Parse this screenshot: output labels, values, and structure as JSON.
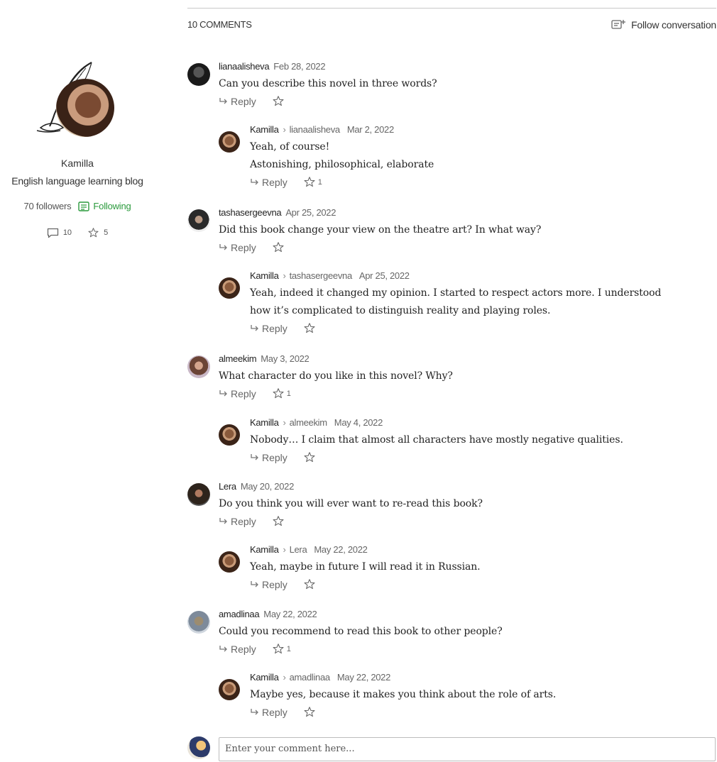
{
  "blog": {
    "name": "Kamilla",
    "description": "English language learning blog",
    "followers": "70 followers",
    "following": "Following",
    "comments_count": "10",
    "stars_count": "5"
  },
  "header": {
    "count": "10 COMMENTS",
    "follow": "Follow conversation"
  },
  "labels": {
    "reply": "Reply"
  },
  "comments": [
    {
      "author": "lianaalisheva",
      "date": "Feb 28, 2022",
      "text": [
        "Can you describe this novel in three words?"
      ],
      "stars": ""
    },
    {
      "author": "Kamilla",
      "to": "lianaalisheva",
      "date": "Mar 2, 2022",
      "text": [
        "Yeah, of course!",
        "Astonishing, philosophical, elaborate"
      ],
      "stars": "1"
    },
    {
      "author": "tashasergeevna",
      "date": "Apr 25, 2022",
      "text": [
        "Did this book change your view on the theatre art? In what way?"
      ],
      "stars": ""
    },
    {
      "author": "Kamilla",
      "to": "tashasergeevna",
      "date": "Apr 25, 2022",
      "text": [
        "Yeah, indeed it changed my opinion. I started to respect actors more. I understood",
        "how it’s complicated to distinguish reality and playing roles."
      ],
      "stars": ""
    },
    {
      "author": "almeekim",
      "date": "May 3, 2022",
      "text": [
        "What character do you like in this novel? Why?"
      ],
      "stars": "1"
    },
    {
      "author": "Kamilla",
      "to": "almeekim",
      "date": "May 4, 2022",
      "text": [
        "Nobody… I claim that almost all characters have mostly negative qualities."
      ],
      "stars": ""
    },
    {
      "author": "Lera",
      "date": "May 20, 2022",
      "text": [
        "Do you think you will ever want to re-read this book?"
      ],
      "stars": ""
    },
    {
      "author": "Kamilla",
      "to": "Lera",
      "date": "May 22, 2022",
      "text": [
        "Yeah, maybe in future I will read it in Russian."
      ],
      "stars": ""
    },
    {
      "author": "amadlinaa",
      "date": "May 22, 2022",
      "text": [
        "Could you recommend to read this book to other people?"
      ],
      "stars": "1"
    },
    {
      "author": "Kamilla",
      "to": "amadlinaa",
      "date": "May 22, 2022",
      "text": [
        "Maybe yes, because it makes you think about the role of arts."
      ],
      "stars": ""
    }
  ],
  "input": {
    "placeholder": "Enter your comment here..."
  }
}
